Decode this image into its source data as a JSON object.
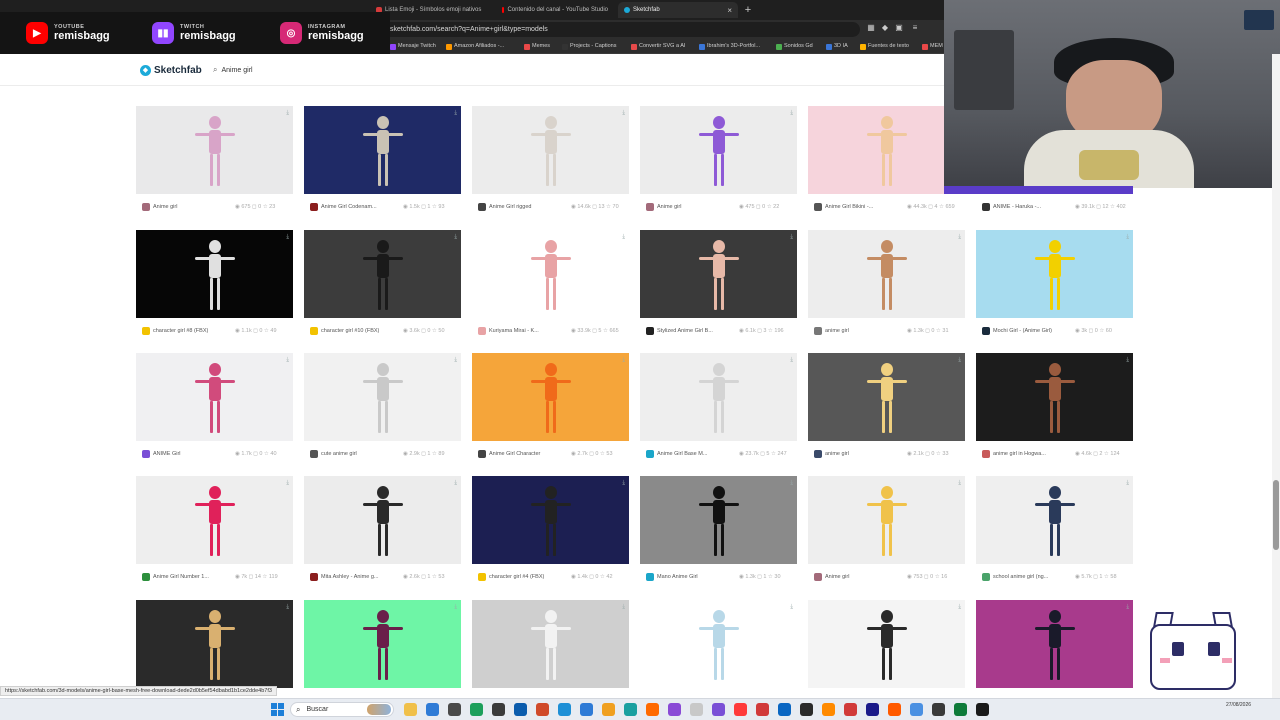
{
  "browser": {
    "tabs": [
      {
        "label": "Lista Emoji - Símbolos emoji nativos",
        "color": "#d63b3b",
        "active": false
      },
      {
        "label": "Contenido del canal - YouTube Studio",
        "color": "#ff0000",
        "active": false
      },
      {
        "label": "Sketchfab",
        "color": "#1caad9",
        "active": true
      }
    ],
    "url": "sketchfab.com/search?q=Anime+girl&type=models",
    "bookmarks": [
      {
        "label": "Mensaje Twitch",
        "color": "#9146ff"
      },
      {
        "label": "Amazon Afiliados -...",
        "color": "#ff9900"
      },
      {
        "label": "Memes",
        "color": "#e94848"
      },
      {
        "label": "Projects - Captions",
        "color": "#333333"
      },
      {
        "label": "Convertir SVG a AI",
        "color": "#e64a4a"
      },
      {
        "label": "Ibrahim's 3D-Portfol...",
        "color": "#3a76d8"
      },
      {
        "label": "Sonidos Gd",
        "color": "#4caf50"
      },
      {
        "label": "3D IA",
        "color": "#3a76d8"
      },
      {
        "label": "Fuentes de texto",
        "color": "#ffb300"
      },
      {
        "label": "MEM",
        "color": "#e94848"
      }
    ]
  },
  "social": [
    {
      "platform": "YOUTUBE",
      "user": "remisbagg",
      "color": "#ff0000",
      "icon": "youtube-icon"
    },
    {
      "platform": "TWITCH",
      "user": "remisbagg",
      "color": "#9146ff",
      "icon": "twitch-icon"
    },
    {
      "platform": "INSTAGRAM",
      "user": "remisbagg",
      "color": "#d62976",
      "icon": "instagram-icon"
    }
  ],
  "sketchfab": {
    "logo": "Sketchfab",
    "search_query": "Anime girl"
  },
  "cards": [
    {
      "name": "Anime girl",
      "stats": "◉ 675 ◻ 0 ☆ 23",
      "bg": "#e9e9ea",
      "fig": "#d8a4c8",
      "avatar": "#a36a7a"
    },
    {
      "name": "Anime Girl Codenam...",
      "stats": "◉ 1.5k ◻ 1 ☆ 93",
      "bg": "#1f2a66",
      "fig": "#c9c2b4",
      "avatar": "#8b1e1e"
    },
    {
      "name": "Anime Girl rigged",
      "stats": "◉ 14.6k ◻ 13 ☆ 70",
      "bg": "#ececec",
      "fig": "#d9d3cc",
      "avatar": "#444444"
    },
    {
      "name": "Anime girl",
      "stats": "◉ 475 ◻ 0 ☆ 22",
      "bg": "#ececec",
      "fig": "#8e5ad6",
      "avatar": "#a36a7a"
    },
    {
      "name": "Anime Girl Bikini -...",
      "stats": "◉ 44.3k ◻ 4 ☆ 659",
      "bg": "#f6d4dc",
      "fig": "#f0c89e",
      "avatar": "#555555"
    },
    {
      "name": "ANIME - Haruka -...",
      "stats": "◉ 39.1k ◻ 12 ☆ 402",
      "bg": "#e8e8ea",
      "fig": "#cfa27e",
      "avatar": "#333333"
    },
    {
      "name": "character girl #8 (FBX)",
      "stats": "◉ 1.1k ◻ 0 ☆ 49",
      "bg": "#060606",
      "fig": "#e0e0e0",
      "avatar": "#f2c200"
    },
    {
      "name": "character girl #10 (FBX)",
      "stats": "◉ 3.6k ◻ 0 ☆ 50",
      "bg": "#3c3c3c",
      "fig": "#1a1a1a",
      "avatar": "#f2c200"
    },
    {
      "name": "Kuriyama Mirai - K...",
      "stats": "◉ 33.9k ◻ 5 ☆ 665",
      "bg": "#ffffff",
      "fig": "#e8a3a5",
      "avatar": "#e8a3a5"
    },
    {
      "name": "Stylized Anime Girl B...",
      "stats": "◉ 6.1k ◻ 3 ☆ 196",
      "bg": "#3a3a3a",
      "fig": "#e7b9a8",
      "avatar": "#222222"
    },
    {
      "name": "anime girl",
      "stats": "◉ 1.3k ◻ 0 ☆ 31",
      "bg": "#ededed",
      "fig": "#c48c63",
      "avatar": "#777777"
    },
    {
      "name": "Mochi Girl - (Anime Girl)",
      "stats": "◉ 3k ◻ 0 ☆ 60",
      "bg": "#a7dcef",
      "fig": "#f2d000",
      "avatar": "#1a2b3c"
    },
    {
      "name": "ANIME Girl",
      "stats": "◉ 1.7k ◻ 0 ☆ 40",
      "bg": "#f0f0f2",
      "fig": "#d14b7c",
      "avatar": "#7a4fd6"
    },
    {
      "name": "cute anime girl",
      "stats": "◉ 2.9k ◻ 1 ☆ 89",
      "bg": "#f1f1f1",
      "fig": "#c9c9c9",
      "avatar": "#555555"
    },
    {
      "name": "Anime Girl Character",
      "stats": "◉ 2.7k ◻ 0 ☆ 53",
      "bg": "#f5a53a",
      "fig": "#f06a1a",
      "avatar": "#444444"
    },
    {
      "name": "Anime Girl Base M...",
      "stats": "◉ 23.7k ◻ 5 ☆ 247",
      "bg": "#eeeeee",
      "fig": "#d4d4d4",
      "avatar": "#1ba6c9"
    },
    {
      "name": "anime girl",
      "stats": "◉ 2.1k ◻ 0 ☆ 33",
      "bg": "#575757",
      "fig": "#f0d080",
      "avatar": "#3a4a6a"
    },
    {
      "name": "anime girl in Hogwa...",
      "stats": "◉ 4.6k ◻ 2 ☆ 124",
      "bg": "#1c1c1c",
      "fig": "#9a5b3e",
      "avatar": "#c85a5a"
    },
    {
      "name": "Anime Girl Number 1...",
      "stats": "◉ 7k ◻ 14 ☆ 119",
      "bg": "#eeeeee",
      "fig": "#e0215a",
      "avatar": "#2c8f3c"
    },
    {
      "name": "Mita Ashley - Anime g...",
      "stats": "◉ 2.6k ◻ 1 ☆ 53",
      "bg": "#ececec",
      "fig": "#2a2a2a",
      "avatar": "#8b1e1e"
    },
    {
      "name": "character girl #4 (FBX)",
      "stats": "◉ 1.4k ◻ 0 ☆ 42",
      "bg": "#1c1f52",
      "fig": "#222222",
      "avatar": "#f2c200"
    },
    {
      "name": "Mano Anime Girl",
      "stats": "◉ 1.3k ◻ 1 ☆ 30",
      "bg": "#8a8a8a",
      "fig": "#111111",
      "avatar": "#1ba6c9"
    },
    {
      "name": "Anime girl",
      "stats": "◉ 753 ◻ 0 ☆ 16",
      "bg": "#eeeeee",
      "fig": "#f0c24a",
      "avatar": "#a36a7a"
    },
    {
      "name": "school anime girl (ng...",
      "stats": "◉ 5.7k ◻ 1 ☆ 58",
      "bg": "#efefef",
      "fig": "#2a3a5a",
      "avatar": "#4aa36a"
    },
    {
      "name": "",
      "stats": "",
      "bg": "#2a2a2a",
      "fig": "#d9b070",
      "avatar": "#555555"
    },
    {
      "name": "",
      "stats": "",
      "bg": "#6ef5a6",
      "fig": "#6a1f4a",
      "avatar": "#555555"
    },
    {
      "name": "",
      "stats": "",
      "bg": "#cfcfcf",
      "fig": "#f2f2f2",
      "avatar": "#555555"
    },
    {
      "name": "",
      "stats": "",
      "bg": "#ffffff",
      "fig": "#b8d8e8",
      "avatar": "#555555"
    },
    {
      "name": "",
      "stats": "",
      "bg": "#f4f4f4",
      "fig": "#2a2a2a",
      "avatar": "#555555"
    },
    {
      "name": "",
      "stats": "",
      "bg": "#a83a8c",
      "fig": "#1a1a2a",
      "avatar": "#555555"
    }
  ],
  "status_url": "https://sketchfab.com/3d-models/anime-girl-base-mesh-free-download-dede2d0b5ef54dbabd1b1ce2dde4b7f3",
  "taskbar": {
    "search_label": "Buscar",
    "date": "27/08/2026",
    "apps": [
      "#f0c04a",
      "#2f7bd6",
      "#4a4a4a",
      "#1d9f5b",
      "#3b3b3b",
      "#0b5cad",
      "#d04a2a",
      "#1e8fd6",
      "#2f7bd6",
      "#f0a020",
      "#1aa0a0",
      "#ff6a00",
      "#8a4ad6",
      "#c8c8c8",
      "#7a4fd6",
      "#ff3a3a",
      "#d13a3a",
      "#0a66c2",
      "#2a2a2a",
      "#ff8a00",
      "#d13a3a",
      "#1a1a8a",
      "#ff5a00",
      "#4a90e2",
      "#3a3a3a",
      "#0f7b3a",
      "#1a1a1a"
    ]
  }
}
